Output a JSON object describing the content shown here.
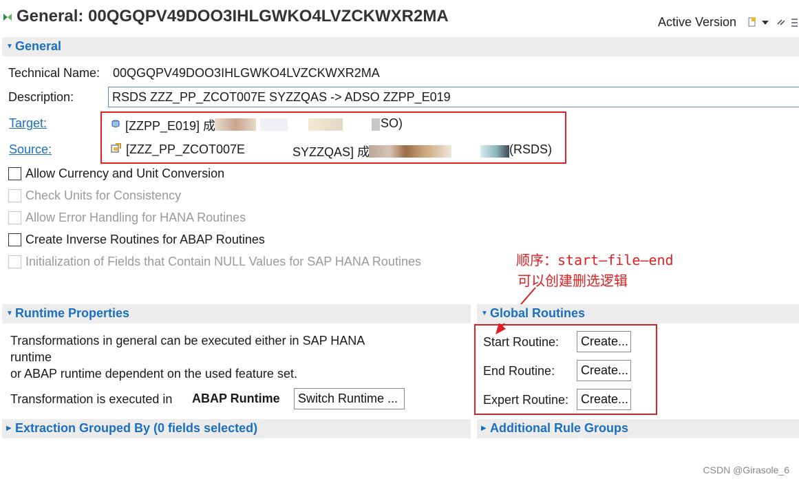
{
  "header": {
    "title": "General: 00QGQPV49DOO3IHLGWKO4LVZCKWXR2MA",
    "version": "Active Version",
    "icons": [
      "transformation-icon",
      "toolbar-edit-icon",
      "dropdown-arrow-icon",
      "toolbar-link-icon",
      "toolbar-collapse-icon"
    ]
  },
  "general": {
    "section_title": "General",
    "technical_name_label": "Technical Name:",
    "technical_name_value": "00QGQPV49DOO3IHLGWKO4LVZCKWXR2MA",
    "description_label": "Description:",
    "description_value": "RSDS ZZZ_PP_ZCOT007E SYZZQAS -> ADSO ZZPP_E019",
    "target_label": "Target:",
    "target_prefix": "[ZZPP_E019] 成",
    "target_suffix": "SO)",
    "source_label": "Source:",
    "source_prefix": "[ZZZ_PP_ZCOT007E",
    "source_middle": "SYZZQAS] 成",
    "source_suffix": "(RSDS)",
    "checkboxes": [
      {
        "label": "Allow Currency and Unit Conversion",
        "enabled": true,
        "checked": false
      },
      {
        "label": "Check Units for Consistency",
        "enabled": false,
        "checked": false
      },
      {
        "label": "Allow Error Handling for HANA Routines",
        "enabled": false,
        "checked": false
      },
      {
        "label": "Create Inverse Routines for ABAP Routines",
        "enabled": true,
        "checked": false
      },
      {
        "label": "Initialization of Fields that Contain NULL Values for SAP HANA Routines",
        "enabled": false,
        "checked": false
      }
    ]
  },
  "annotation": {
    "line1": "顺序：start—file—end",
    "line2": "可以创建删选逻辑"
  },
  "runtime": {
    "section_title": "Runtime Properties",
    "desc_line1": "Transformations in general can be executed either in SAP HANA",
    "desc_line2": "runtime",
    "desc_line3": "or ABAP runtime dependent on the used feature set.",
    "executed_label": "Transformation is executed in",
    "runtime_value": "ABAP Runtime",
    "switch_button": "Switch Runtime ..."
  },
  "global_routines": {
    "section_title": "Global Routines",
    "start_label": "Start Routine:",
    "end_label": "End Routine:",
    "expert_label": "Expert Routine:",
    "create_button": "Create..."
  },
  "extraction": {
    "section_title": "Extraction Grouped By (0 fields selected)"
  },
  "additional": {
    "section_title": "Additional Rule Groups"
  },
  "watermark": "CSDN @Girasole_6",
  "colors": {
    "link": "#1a6fc0",
    "annotation": "#e02020",
    "section_bg": "#ececec"
  }
}
